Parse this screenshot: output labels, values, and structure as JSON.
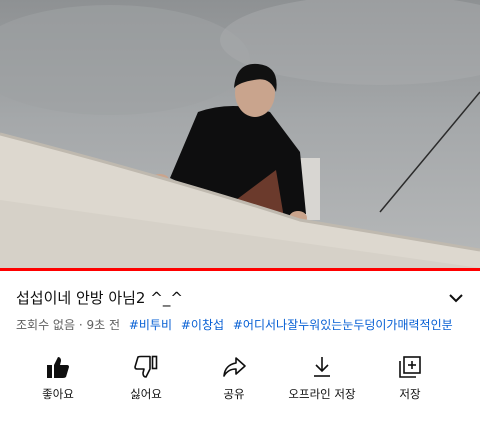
{
  "video": {
    "title": "섭섭이네 안방 아님2 ^_^",
    "progress_percent": 100
  },
  "meta": {
    "views": "조회수 없음 · 9초 전",
    "hashtags": [
      "#비투비",
      "#이창섭",
      "#어디서나잘누워있는눈두덩이가매력적인분"
    ]
  },
  "actions": {
    "like": "좋아요",
    "dislike": "싫어요",
    "share": "공유",
    "offline_save": "오프라인 저장",
    "save": "저장"
  },
  "colors": {
    "progress": "#ff0000",
    "hashtag": "#065fd4",
    "secondary_text": "#606060"
  }
}
